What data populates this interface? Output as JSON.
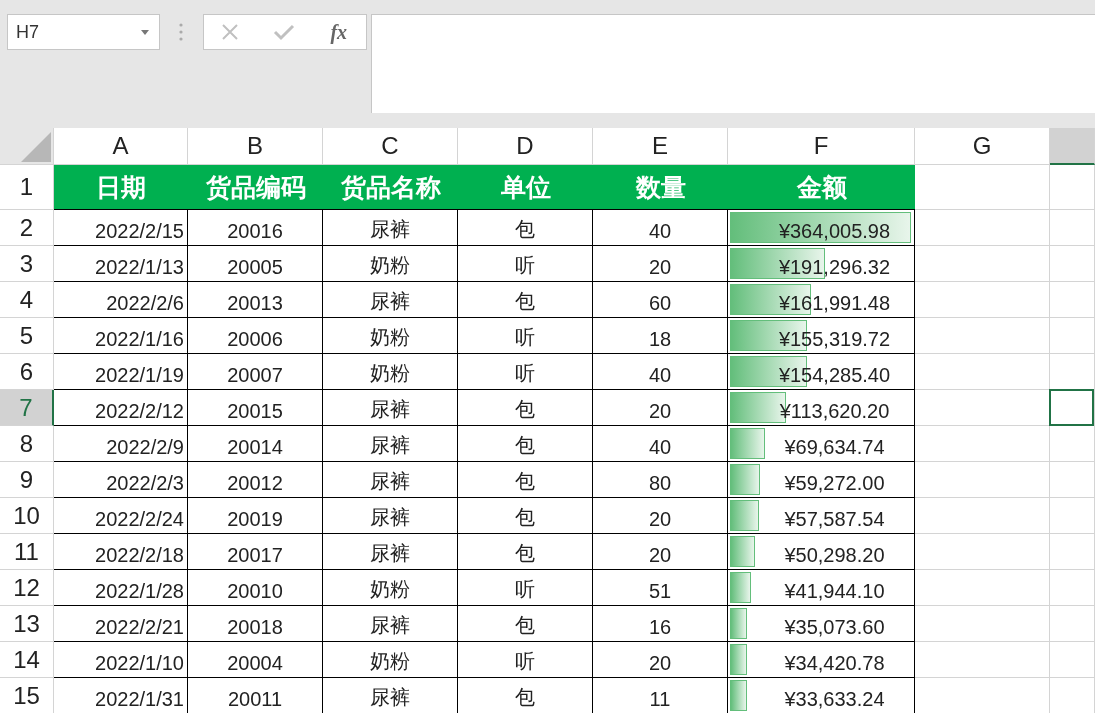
{
  "name_box": {
    "value": "H7"
  },
  "formula_bar": {
    "fx_label": "fx"
  },
  "columns": [
    "A",
    "B",
    "C",
    "D",
    "E",
    "F",
    "G"
  ],
  "header_row": {
    "number": "1",
    "cells": [
      "日期",
      "货品编码",
      "货品名称",
      "单位",
      "数量",
      "金额"
    ]
  },
  "rows": [
    {
      "number": "2",
      "selected": false,
      "date": "2022/2/15",
      "code": "20016",
      "name": "尿裤",
      "unit": "包",
      "qty": "40",
      "amount": "¥364,005.98",
      "level": 1.0
    },
    {
      "number": "3",
      "selected": false,
      "date": "2022/1/13",
      "code": "20005",
      "name": "奶粉",
      "unit": "听",
      "qty": "20",
      "amount": "¥191,296.32",
      "level": 0.526
    },
    {
      "number": "4",
      "selected": false,
      "date": "2022/2/6",
      "code": "20013",
      "name": "尿裤",
      "unit": "包",
      "qty": "60",
      "amount": "¥161,991.48",
      "level": 0.445
    },
    {
      "number": "5",
      "selected": false,
      "date": "2022/1/16",
      "code": "20006",
      "name": "奶粉",
      "unit": "听",
      "qty": "18",
      "amount": "¥155,319.72",
      "level": 0.427
    },
    {
      "number": "6",
      "selected": false,
      "date": "2022/1/19",
      "code": "20007",
      "name": "奶粉",
      "unit": "听",
      "qty": "40",
      "amount": "¥154,285.40",
      "level": 0.424
    },
    {
      "number": "7",
      "selected": true,
      "date": "2022/2/12",
      "code": "20015",
      "name": "尿裤",
      "unit": "包",
      "qty": "20",
      "amount": "¥113,620.20",
      "level": 0.312
    },
    {
      "number": "8",
      "selected": false,
      "date": "2022/2/9",
      "code": "20014",
      "name": "尿裤",
      "unit": "包",
      "qty": "40",
      "amount": "¥69,634.74",
      "level": 0.191
    },
    {
      "number": "9",
      "selected": false,
      "date": "2022/2/3",
      "code": "20012",
      "name": "尿裤",
      "unit": "包",
      "qty": "80",
      "amount": "¥59,272.00",
      "level": 0.163
    },
    {
      "number": "10",
      "selected": false,
      "date": "2022/2/24",
      "code": "20019",
      "name": "尿裤",
      "unit": "包",
      "qty": "20",
      "amount": "¥57,587.54",
      "level": 0.158
    },
    {
      "number": "11",
      "selected": false,
      "date": "2022/2/18",
      "code": "20017",
      "name": "尿裤",
      "unit": "包",
      "qty": "20",
      "amount": "¥50,298.20",
      "level": 0.138
    },
    {
      "number": "12",
      "selected": false,
      "date": "2022/1/28",
      "code": "20010",
      "name": "奶粉",
      "unit": "听",
      "qty": "51",
      "amount": "¥41,944.10",
      "level": 0.115
    },
    {
      "number": "13",
      "selected": false,
      "date": "2022/2/21",
      "code": "20018",
      "name": "尿裤",
      "unit": "包",
      "qty": "16",
      "amount": "¥35,073.60",
      "level": 0.096
    },
    {
      "number": "14",
      "selected": false,
      "date": "2022/1/10",
      "code": "20004",
      "name": "奶粉",
      "unit": "听",
      "qty": "20",
      "amount": "¥34,420.78",
      "level": 0.095
    },
    {
      "number": "15",
      "selected": false,
      "date": "2022/1/31",
      "code": "20011",
      "name": "尿裤",
      "unit": "包",
      "qty": "11",
      "amount": "¥33,633.24",
      "level": 0.092
    }
  ]
}
